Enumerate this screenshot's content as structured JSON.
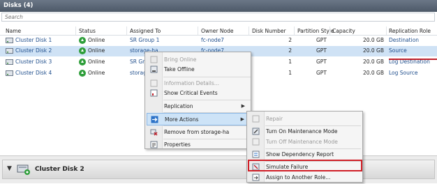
{
  "panel": {
    "title": "Disks (4)"
  },
  "search": {
    "placeholder": "Search"
  },
  "columns": [
    "Name",
    "Status",
    "Assigned To",
    "Owner Node",
    "Disk Number",
    "Partition Style",
    "Capacity",
    "Replication Role"
  ],
  "rows": [
    {
      "name": "Cluster Disk 1",
      "status": "Online",
      "assigned": "SR Group 1",
      "owner": "fc-node7",
      "disk_number": "2",
      "partition": "GPT",
      "capacity": "20.0 GB",
      "role": "Destination"
    },
    {
      "name": "Cluster Disk 2",
      "status": "Online",
      "assigned": "storage-ha",
      "owner": "fc-node7",
      "disk_number": "2",
      "partition": "GPT",
      "capacity": "20.0 GB",
      "role": "Source"
    },
    {
      "name": "Cluster Disk 3",
      "status": "Online",
      "assigned": "SR Gr",
      "owner": "",
      "disk_number": "1",
      "partition": "GPT",
      "capacity": "20.0 GB",
      "role": "Log Destination"
    },
    {
      "name": "Cluster Disk 4",
      "status": "Online",
      "assigned": "storag",
      "owner": "",
      "disk_number": "1",
      "partition": "GPT",
      "capacity": "20.0 GB",
      "role": "Log Source"
    }
  ],
  "context_menu": {
    "items": [
      {
        "label": "Bring Online",
        "disabled": true,
        "icon": "bring-online-icon"
      },
      {
        "label": "Take Offline",
        "disabled": false,
        "icon": "take-offline-icon"
      },
      {
        "label": "Information Details...",
        "disabled": true,
        "icon": "information-icon"
      },
      {
        "label": "Show Critical Events",
        "disabled": false,
        "icon": "critical-events-icon"
      },
      {
        "label": "Replication",
        "disabled": false,
        "icon": "",
        "submenu": true
      },
      {
        "label": "More Actions",
        "disabled": false,
        "icon": "more-actions-icon",
        "submenu": true,
        "highlighted": true
      },
      {
        "label": "Remove from storage-ha",
        "disabled": false,
        "icon": "remove-icon"
      },
      {
        "label": "Properties",
        "disabled": false,
        "icon": "properties-icon"
      }
    ]
  },
  "submenu": {
    "items": [
      {
        "label": "Repair",
        "disabled": true,
        "icon": "repair-icon"
      },
      {
        "label": "Turn On Maintenance Mode",
        "disabled": false,
        "icon": "maintenance-on-icon"
      },
      {
        "label": "Turn Off Maintenance Mode",
        "disabled": true,
        "icon": "maintenance-off-icon"
      },
      {
        "label": "Show Dependency Report",
        "disabled": false,
        "icon": "dependency-report-icon"
      },
      {
        "label": "Simulate Failure",
        "disabled": false,
        "icon": "simulate-failure-icon"
      },
      {
        "label": "Assign to Another Role...",
        "disabled": false,
        "icon": "assign-role-icon"
      }
    ]
  },
  "details": {
    "title": "Cluster Disk 2"
  },
  "colors": {
    "accent": "#d01f27",
    "selection": "#cfe2f5",
    "link": "#1f4e8c",
    "online": "#2e9e3a"
  }
}
